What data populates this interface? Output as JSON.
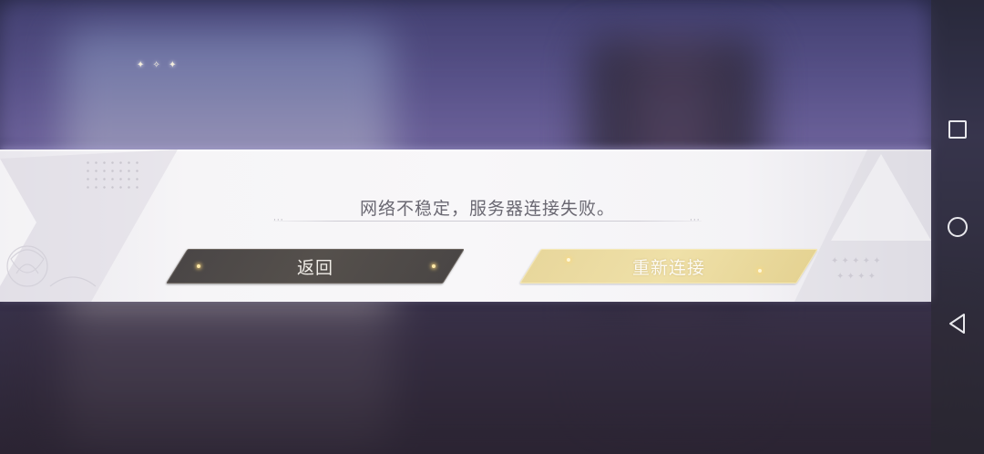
{
  "dialog": {
    "message": "网络不稳定，服务器连接失败。",
    "message_dots_left": "···",
    "message_dots_right": "···"
  },
  "buttons": {
    "back_label": "返回",
    "retry_label": "重新连接"
  },
  "navbar": {
    "icons": [
      "recent-apps-icon",
      "home-icon",
      "back-icon"
    ]
  },
  "colors": {
    "back_button": "#4e4a48",
    "retry_button": "#ecdca2",
    "message_text": "#6a6872",
    "dialog_bg": "#f6f5f7"
  }
}
